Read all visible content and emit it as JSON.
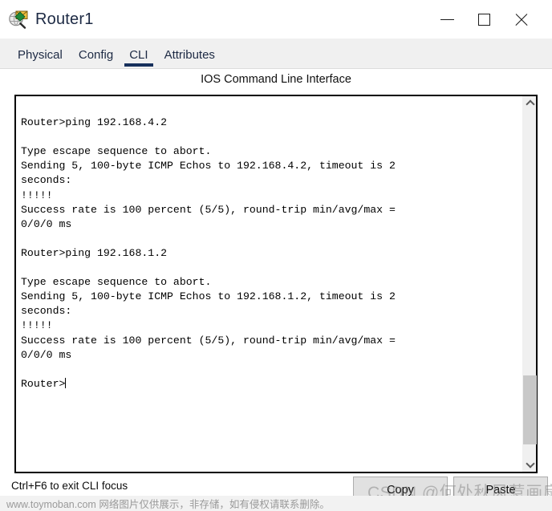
{
  "window": {
    "title": "Router1",
    "icon": "inspect-device-icon",
    "controls": {
      "minimize": "minimize-icon",
      "maximize": "maximize-icon",
      "close": "close-icon"
    }
  },
  "tabs": [
    {
      "label": "Physical",
      "active": false
    },
    {
      "label": "Config",
      "active": false
    },
    {
      "label": "CLI",
      "active": true
    },
    {
      "label": "Attributes",
      "active": false
    }
  ],
  "cli": {
    "caption": "IOS Command Line Interface",
    "prompt": "Router>",
    "accent_color": "#17305c",
    "terminal_text": "\nRouter>ping 192.168.4.2\n\nType escape sequence to abort.\nSending 5, 100-byte ICMP Echos to 192.168.4.2, timeout is 2\nseconds:\n!!!!!\nSuccess rate is 100 percent (5/5), round-trip min/avg/max =\n0/0/0 ms\n\nRouter>ping 192.168.1.2\n\nType escape sequence to abort.\nSending 5, 100-byte ICMP Echos to 192.168.1.2, timeout is 2\nseconds:\n!!!!!\nSuccess rate is 100 percent (5/5), round-trip min/avg/max =\n0/0/0 ms\n\nRouter>",
    "lines": [
      "",
      "Router>ping 192.168.4.2",
      "",
      "Type escape sequence to abort.",
      "Sending 5, 100-byte ICMP Echos to 192.168.4.2, timeout is 2",
      "seconds:",
      "!!!!!",
      "Success rate is 100 percent (5/5), round-trip min/avg/max =",
      "0/0/0 ms",
      "",
      "Router>ping 192.168.1.2",
      "",
      "Type escape sequence to abort.",
      "Sending 5, 100-byte ICMP Echos to 192.168.1.2, timeout is 2",
      "seconds:",
      "!!!!!",
      "Success rate is 100 percent (5/5), round-trip min/avg/max =",
      "0/0/0 ms",
      "",
      "Router>"
    ],
    "scrollbar": {
      "up_arrow": "chevron-up-icon",
      "down_arrow": "chevron-down-icon"
    }
  },
  "footer": {
    "focus_hint": "Ctrl+F6 to exit CLI focus",
    "copy_label": "Copy",
    "paste_label": "Paste"
  },
  "watermarks": {
    "csdn": "CSDN @何处秋风惹画扇",
    "bottom": "www.toymoban.com 网络图片仅供展示，非存储，如有侵权请联系删除。"
  }
}
